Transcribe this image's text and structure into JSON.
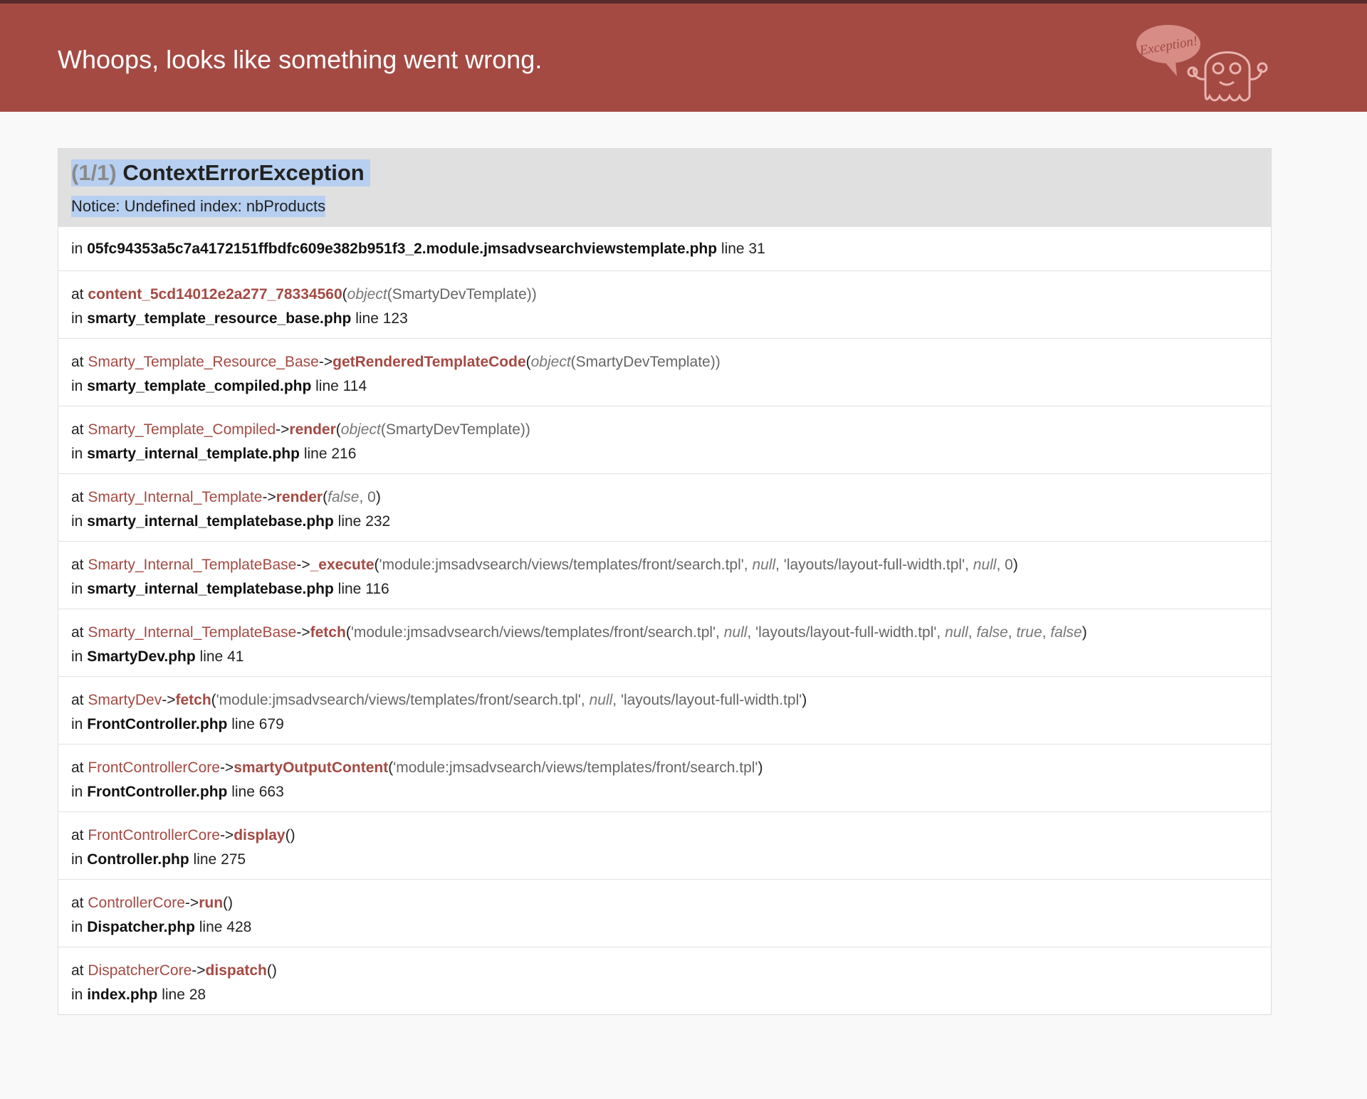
{
  "header": {
    "title": "Whoops, looks like something went wrong.",
    "mascot_label": "Exception!"
  },
  "exception": {
    "count": "(1/1)",
    "name": "ContextErrorException",
    "message": "Notice: Undefined index: nbProducts"
  },
  "origin": {
    "prefix": "in",
    "file": "05fc94353a5c7a4172151ffbdfc609e382b951f3_2.module.jmsadvsearchviewstemplate.php",
    "line": "line 31"
  },
  "frames": [
    {
      "at": "at",
      "cls": "",
      "arrow": "",
      "fn": "content_5cd14012e2a277_78334560",
      "args": [
        {
          "t": "(",
          "k": "p"
        },
        {
          "t": "object",
          "k": "i"
        },
        {
          "t": "(SmartyDevTemplate))",
          "k": "a"
        }
      ],
      "in": "in",
      "file": "smarty_template_resource_base.php",
      "line": "line 123"
    },
    {
      "at": "at",
      "cls": "Smarty_Template_Resource_Base",
      "arrow": "->",
      "fn": "getRenderedTemplateCode",
      "args": [
        {
          "t": "(",
          "k": "p"
        },
        {
          "t": "object",
          "k": "i"
        },
        {
          "t": "(SmartyDevTemplate))",
          "k": "a"
        }
      ],
      "in": "in",
      "file": "smarty_template_compiled.php",
      "line": "line 114"
    },
    {
      "at": "at",
      "cls": "Smarty_Template_Compiled",
      "arrow": "->",
      "fn": "render",
      "args": [
        {
          "t": "(",
          "k": "p"
        },
        {
          "t": "object",
          "k": "i"
        },
        {
          "t": "(SmartyDevTemplate))",
          "k": "a"
        }
      ],
      "in": "in",
      "file": "smarty_internal_template.php",
      "line": "line 216"
    },
    {
      "at": "at",
      "cls": "Smarty_Internal_Template",
      "arrow": "->",
      "fn": "render",
      "args": [
        {
          "t": "(",
          "k": "p"
        },
        {
          "t": "false",
          "k": "i"
        },
        {
          "t": ", 0",
          "k": "a"
        },
        {
          "t": ")",
          "k": "p"
        }
      ],
      "in": "in",
      "file": "smarty_internal_templatebase.php",
      "line": "line 232"
    },
    {
      "at": "at",
      "cls": "Smarty_Internal_TemplateBase",
      "arrow": "->",
      "fn": "_execute",
      "args": [
        {
          "t": "(",
          "k": "p"
        },
        {
          "t": "'module:jmsadvsearch/views/templates/front/search.tpl', ",
          "k": "a"
        },
        {
          "t": "null",
          "k": "i"
        },
        {
          "t": ", 'layouts/layout-full-width.tpl', ",
          "k": "a"
        },
        {
          "t": "null",
          "k": "i"
        },
        {
          "t": ", 0",
          "k": "a"
        },
        {
          "t": ")",
          "k": "p"
        }
      ],
      "in": "in",
      "file": "smarty_internal_templatebase.php",
      "line": "line 116"
    },
    {
      "at": "at",
      "cls": "Smarty_Internal_TemplateBase",
      "arrow": "->",
      "fn": "fetch",
      "args": [
        {
          "t": "(",
          "k": "p"
        },
        {
          "t": "'module:jmsadvsearch/views/templates/front/search.tpl', ",
          "k": "a"
        },
        {
          "t": "null",
          "k": "i"
        },
        {
          "t": ", 'layouts/layout-full-width.tpl', ",
          "k": "a"
        },
        {
          "t": "null",
          "k": "i"
        },
        {
          "t": ", ",
          "k": "a"
        },
        {
          "t": "false",
          "k": "i"
        },
        {
          "t": ", ",
          "k": "a"
        },
        {
          "t": "true",
          "k": "i"
        },
        {
          "t": ", ",
          "k": "a"
        },
        {
          "t": "false",
          "k": "i"
        },
        {
          "t": ")",
          "k": "p"
        }
      ],
      "in": "in",
      "file": "SmartyDev.php",
      "line": "line 41"
    },
    {
      "at": "at",
      "cls": "SmartyDev",
      "arrow": "->",
      "fn": "fetch",
      "args": [
        {
          "t": "(",
          "k": "p"
        },
        {
          "t": "'module:jmsadvsearch/views/templates/front/search.tpl', ",
          "k": "a"
        },
        {
          "t": "null",
          "k": "i"
        },
        {
          "t": ", 'layouts/layout-full-width.tpl'",
          "k": "a"
        },
        {
          "t": ")",
          "k": "p"
        }
      ],
      "in": "in",
      "file": "FrontController.php",
      "line": "line 679"
    },
    {
      "at": "at",
      "cls": "FrontControllerCore",
      "arrow": "->",
      "fn": "smartyOutputContent",
      "args": [
        {
          "t": "(",
          "k": "p"
        },
        {
          "t": "'module:jmsadvsearch/views/templates/front/search.tpl'",
          "k": "a"
        },
        {
          "t": ")",
          "k": "p"
        }
      ],
      "in": "in",
      "file": "FrontController.php",
      "line": "line 663"
    },
    {
      "at": "at",
      "cls": "FrontControllerCore",
      "arrow": "->",
      "fn": "display",
      "args": [
        {
          "t": "()",
          "k": "p"
        }
      ],
      "in": "in",
      "file": "Controller.php",
      "line": "line 275"
    },
    {
      "at": "at",
      "cls": "ControllerCore",
      "arrow": "->",
      "fn": "run",
      "args": [
        {
          "t": "()",
          "k": "p"
        }
      ],
      "in": "in",
      "file": "Dispatcher.php",
      "line": "line 428"
    },
    {
      "at": "at",
      "cls": "DispatcherCore",
      "arrow": "->",
      "fn": "dispatch",
      "args": [
        {
          "t": "()",
          "k": "p"
        }
      ],
      "in": "in",
      "file": "index.php",
      "line": "line 28"
    }
  ]
}
